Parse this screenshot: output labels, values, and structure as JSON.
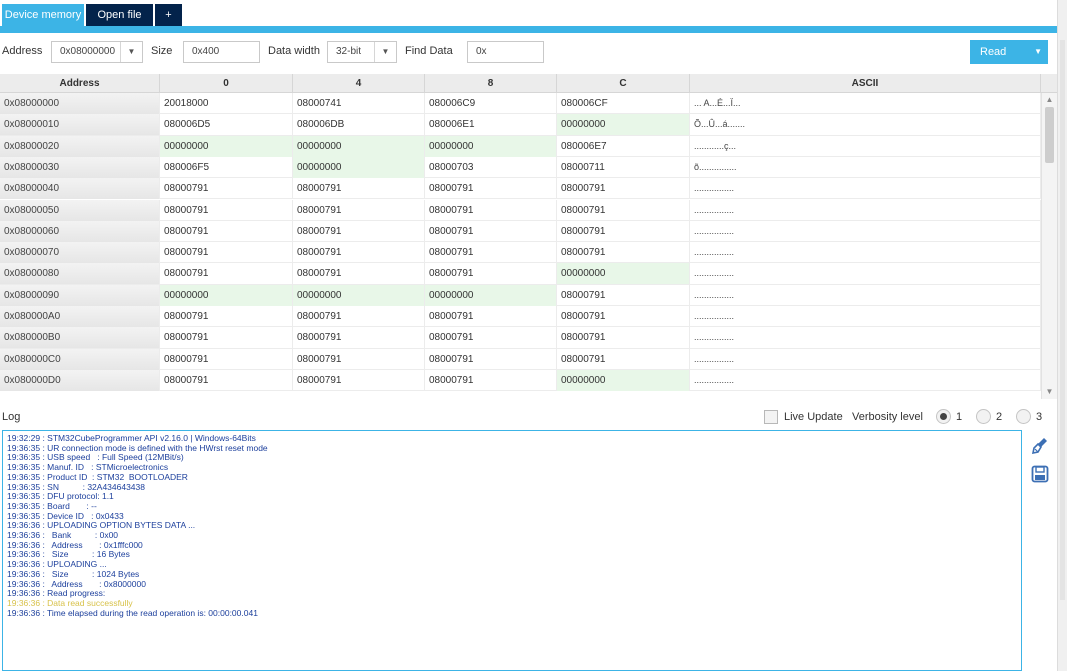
{
  "tabs": [
    {
      "label": "Device memory"
    },
    {
      "label": "Open file"
    },
    {
      "label": "+"
    }
  ],
  "toolbar": {
    "address_label": "Address",
    "address_value": "0x08000000",
    "size_label": "Size",
    "size_value": "0x400",
    "data_width_label": "Data width",
    "data_width_value": "32-bit",
    "find_label": "Find Data",
    "find_value": "0x",
    "read_label": "Read"
  },
  "grid": {
    "columns": [
      "Address",
      "0",
      "4",
      "8",
      "C",
      "ASCII"
    ],
    "rows": [
      {
        "addr": "0x08000000",
        "c0": "20018000",
        "c4": "08000741",
        "c8": "080006C9",
        "cC": "080006CF",
        "ascii": "... A...É...Ï..."
      },
      {
        "addr": "0x08000010",
        "c0": "080006D5",
        "c4": "080006DB",
        "c8": "080006E1",
        "cC": "00000000",
        "ascii": "Õ...Û...á......."
      },
      {
        "addr": "0x08000020",
        "c0": "00000000",
        "c4": "00000000",
        "c8": "00000000",
        "cC": "080006E7",
        "ascii": "............ç..."
      },
      {
        "addr": "0x08000030",
        "c0": "080006F5",
        "c4": "00000000",
        "c8": "08000703",
        "cC": "08000711",
        "ascii": "õ..............."
      },
      {
        "addr": "0x08000040",
        "c0": "08000791",
        "c4": "08000791",
        "c8": "08000791",
        "cC": "08000791",
        "ascii": "................"
      },
      {
        "addr": "0x08000050",
        "c0": "08000791",
        "c4": "08000791",
        "c8": "08000791",
        "cC": "08000791",
        "ascii": "................"
      },
      {
        "addr": "0x08000060",
        "c0": "08000791",
        "c4": "08000791",
        "c8": "08000791",
        "cC": "08000791",
        "ascii": "................"
      },
      {
        "addr": "0x08000070",
        "c0": "08000791",
        "c4": "08000791",
        "c8": "08000791",
        "cC": "08000791",
        "ascii": "................"
      },
      {
        "addr": "0x08000080",
        "c0": "08000791",
        "c4": "08000791",
        "c8": "08000791",
        "cC": "00000000",
        "ascii": "................"
      },
      {
        "addr": "0x08000090",
        "c0": "00000000",
        "c4": "00000000",
        "c8": "00000000",
        "cC": "08000791",
        "ascii": "................"
      },
      {
        "addr": "0x080000A0",
        "c0": "08000791",
        "c4": "08000791",
        "c8": "08000791",
        "cC": "08000791",
        "ascii": "................"
      },
      {
        "addr": "0x080000B0",
        "c0": "08000791",
        "c4": "08000791",
        "c8": "08000791",
        "cC": "08000791",
        "ascii": "................"
      },
      {
        "addr": "0x080000C0",
        "c0": "08000791",
        "c4": "08000791",
        "c8": "08000791",
        "cC": "08000791",
        "ascii": "................"
      },
      {
        "addr": "0x080000D0",
        "c0": "08000791",
        "c4": "08000791",
        "c8": "08000791",
        "cC": "00000000",
        "ascii": "................"
      }
    ]
  },
  "log": {
    "title": "Log",
    "live_update_label": "Live Update",
    "verbosity_label": "Verbosity level",
    "verbosity_options": [
      "1",
      "2",
      "3"
    ],
    "verbosity_selected": "1",
    "lines": [
      {
        "text": "19:32:29 : STM32CubeProgrammer API v2.16.0 | Windows-64Bits",
        "kind": "info"
      },
      {
        "text": "19:36:35 : UR connection mode is defined with the HWrst reset mode",
        "kind": "info"
      },
      {
        "text": "19:36:35 : USB speed   : Full Speed (12MBit/s)",
        "kind": "info"
      },
      {
        "text": "19:36:35 : Manuf. ID   : STMicroelectronics",
        "kind": "info"
      },
      {
        "text": "19:36:35 : Product ID  : STM32  BOOTLOADER",
        "kind": "info"
      },
      {
        "text": "19:36:35 : SN          : 32A434643438",
        "kind": "info"
      },
      {
        "text": "19:36:35 : DFU protocol: 1.1",
        "kind": "info"
      },
      {
        "text": "19:36:35 : Board       : --",
        "kind": "info"
      },
      {
        "text": "19:36:35 : Device ID   : 0x0433",
        "kind": "info"
      },
      {
        "text": "19:36:36 : UPLOADING OPTION BYTES DATA ...",
        "kind": "info"
      },
      {
        "text": "19:36:36 :   Bank          : 0x00",
        "kind": "info"
      },
      {
        "text": "19:36:36 :   Address       : 0x1fffc000",
        "kind": "info"
      },
      {
        "text": "19:36:36 :   Size          : 16 Bytes",
        "kind": "info"
      },
      {
        "text": "19:36:36 : UPLOADING ...",
        "kind": "info"
      },
      {
        "text": "19:36:36 :   Size          : 1024 Bytes",
        "kind": "info"
      },
      {
        "text": "19:36:36 :   Address       : 0x8000000",
        "kind": "info"
      },
      {
        "text": "19:36:36 : Read progress:",
        "kind": "info"
      },
      {
        "text": "19:36:36 : Data read successfully",
        "kind": "ok"
      },
      {
        "text": "19:36:36 : Time elapsed during the read operation is: 00:00:00.041",
        "kind": "info"
      }
    ]
  },
  "icons": {
    "clear_log": "broom-icon",
    "save_log": "save-icon",
    "dropdown": "chevron-down-icon"
  },
  "colors": {
    "accent": "#3cb4e6",
    "tab_dark": "#03234b",
    "zero_cell": "#e8f7e8",
    "log_text": "#1c3f9c",
    "log_ok": "#d8c24a"
  }
}
